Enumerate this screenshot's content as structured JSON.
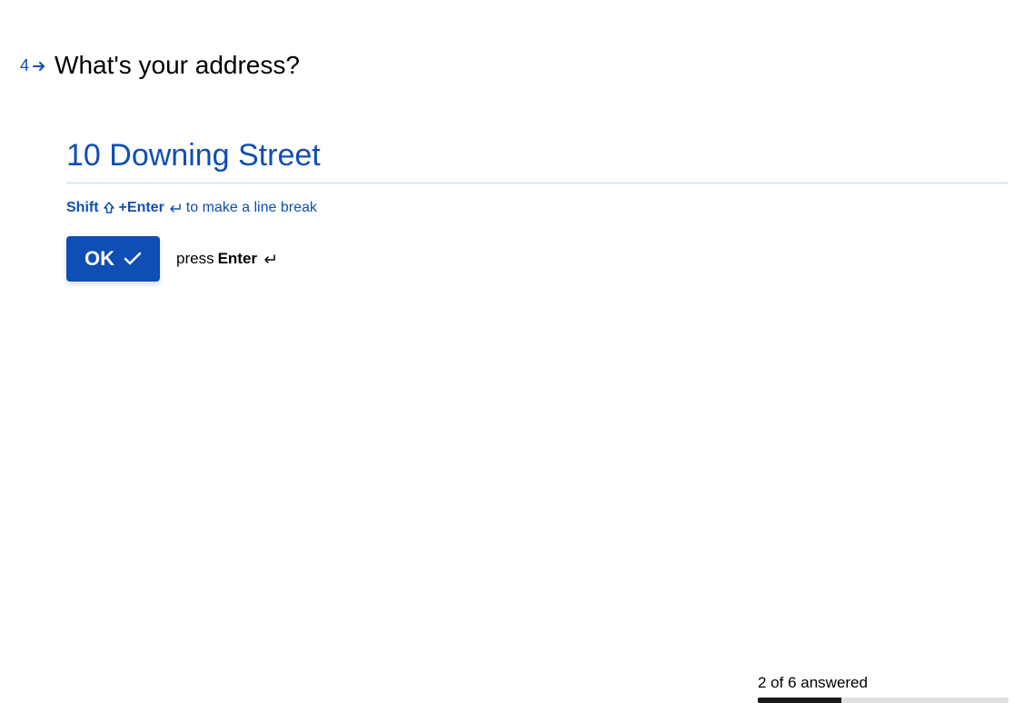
{
  "question": {
    "number": "4",
    "title": "What's your address?",
    "inputValue": "10 Downing Street"
  },
  "hint": {
    "shift": "Shift",
    "plus": " + ",
    "enter": "Enter",
    "tail": " to make a line break"
  },
  "actions": {
    "okLabel": "OK",
    "pressWord": "press ",
    "enterWord": "Enter"
  },
  "progress": {
    "label": "2 of 6 answered"
  },
  "colors": {
    "primary": "#0e4eb5"
  }
}
